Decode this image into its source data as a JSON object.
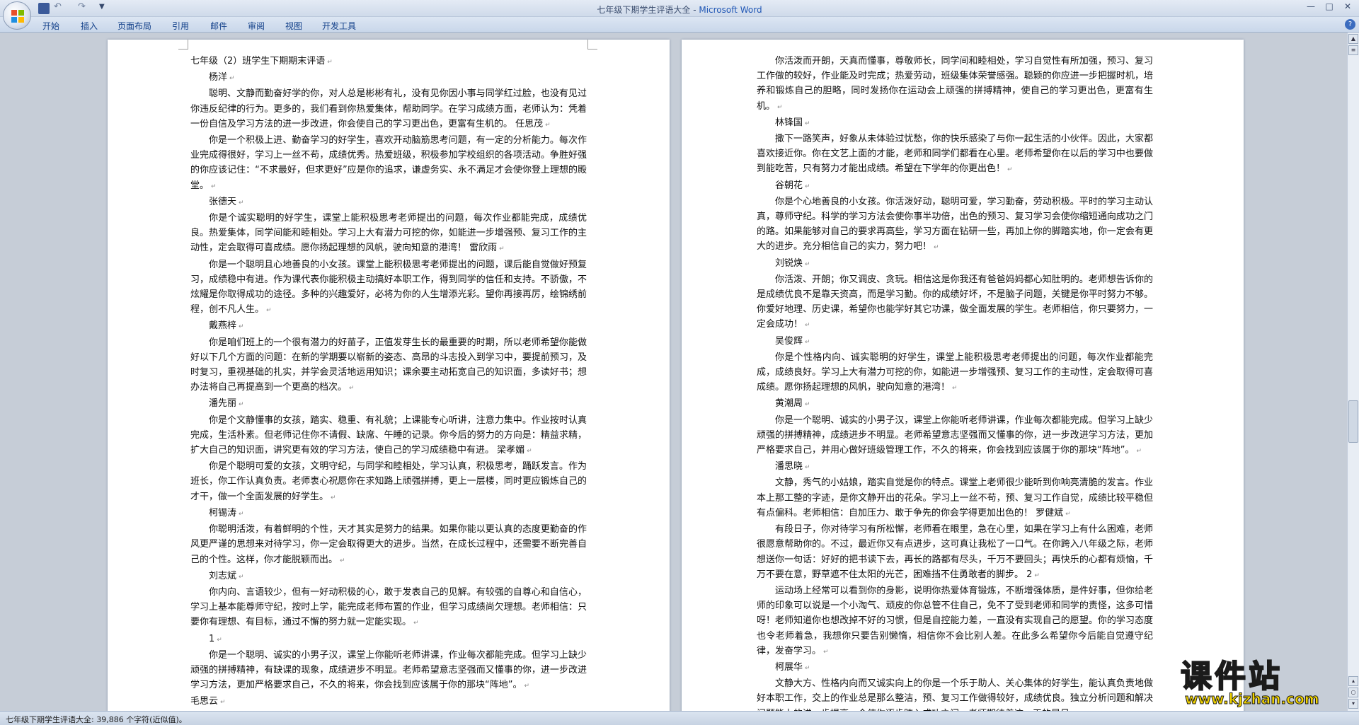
{
  "window": {
    "title_doc": "七年级下期学生评语大全 - ",
    "title_app": "Microsoft Word",
    "minimize": "—",
    "maximize": "□",
    "close": "✕"
  },
  "quick_access": {
    "undo": "↶",
    "redo": "↷",
    "more": "▼"
  },
  "ribbon_tabs": [
    "开始",
    "插入",
    "页面布局",
    "引用",
    "邮件",
    "审阅",
    "视图",
    "开发工具"
  ],
  "help_icon": "?",
  "page1": {
    "paragraphs": [
      {
        "kind": "title",
        "text": "七年级（2）班学生下期期末评语"
      },
      {
        "kind": "name",
        "text": "杨洋"
      },
      {
        "kind": "body",
        "text": "聪明、文静而勤奋好学的你，对人总是彬彬有礼，没有见你因小事与同学红过脸，也没有见过你违反纪律的行为。更多的，我们看到你热爱集体，帮助同学。在学习成绩方面，老师认为：凭着一份自信及学习方法的进一步改进，你会使自己的学习更出色，更富有生机的。 任思茂"
      },
      {
        "kind": "body",
        "text": "你是一个积极上进、勤奋学习的好学生，喜欢开动脑筋思考问题，有一定的分析能力。每次作业完成得很好，学习上一丝不苟，成绩优秀。热爱班级，积极参加学校组织的各项活动。争胜好强的你应该记住：“不求最好，但求更好”应是你的追求，谦虚务实、永不满足才会使你登上理想的殿堂。"
      },
      {
        "kind": "name",
        "text": "张德天"
      },
      {
        "kind": "body",
        "text": "你是个诚实聪明的好学生，课堂上能积极思考老师提出的问题，每次作业都能完成，成绩优良。热爱集体，同学间能和睦相处。学习上大有潜力可挖的你，如能进一步增强预、复习工作的主动性，定会取得可喜成绩。愿你扬起理想的风帆，驶向知意的港湾！ 雷欣雨"
      },
      {
        "kind": "body",
        "text": "你是一个聪明且心地善良的小女孩。课堂上能积极思考老师提出的问题，课后能自觉做好预复习，成绩稳中有进。作为课代表你能积极主动搞好本职工作，得到同学的信任和支持。不骄傲，不炫耀是你取得成功的途径。多种的兴趣爱好，必将为你的人生增添光彩。望你再接再厉，绘锦绣前程，创不凡人生。"
      },
      {
        "kind": "name",
        "text": "戴燕梓"
      },
      {
        "kind": "body",
        "text": "你是咱们班上的一个很有潜力的好苗子，正值发芽生长的最重要的时期，所以老师希望你能做好以下几个方面的问题：在新的学期要以崭新的姿态、高昂的斗志投入到学习中，要提前预习，及时复习，重视基础的扎实，并学会灵活地运用知识；课余要主动拓宽自己的知识面，多读好书；想办法将自己再提高到一个更高的档次。"
      },
      {
        "kind": "name",
        "text": "潘先丽"
      },
      {
        "kind": "body",
        "text": "你是个文静懂事的女孩，踏实、稳重、有礼貌；上课能专心听讲，注意力集中。作业按时认真完成，生活朴素。但老师记住你不请假、缺席、午睡的记录。你今后的努力的方向是：精益求精，扩大自己的知识面，讲究更有效的学习方法，使自己的学习成绩稳中有进。 梁孝媚"
      },
      {
        "kind": "body",
        "text": "你是个聪明可爱的女孩，文明守纪，与同学和睦相处，学习认真，积极思考，踊跃发言。作为班长，你工作认真负责。老师衷心祝愿你在求知路上顽强拼搏，更上一层楼，同时更应锻炼自己的才干，做一个全面发展的好学生。"
      },
      {
        "kind": "name",
        "text": "柯锡涛"
      },
      {
        "kind": "body",
        "text": "你聪明活泼，有着鲜明的个性，天才其实是努力的结果。如果你能以更认真的态度更勤奋的作风更严谨的思想来对待学习，你一定会取得更大的进步。当然，在成长过程中，还需要不断完善自己的个性。这样，你才能脱颖而出。"
      },
      {
        "kind": "name",
        "text": "刘志斌"
      },
      {
        "kind": "body",
        "text": "你内向、言语较少，但有一好动积极的心，敢于发表自己的见解。有较强的自尊心和自信心，学习上基本能尊师守纪，按时上学，能完成老师布置的作业，但学习成绩尚欠理想。老师相信：只要你有理想、有目标，通过不懈的努力就一定能实现。"
      },
      {
        "kind": "name",
        "text": "1"
      },
      {
        "kind": "body",
        "text": "你是一个聪明、诚实的小男子汉，课堂上你能听老师讲课，作业每次都能完成。但学习上缺少顽强的拼搏精神，有缺课的现象，成绩进步不明显。老师希望意志坚强而又懂事的你，进一步改进学习方法，更加严格要求自己，不久的将来，你会找到应该属于你的那块“阵地”。"
      },
      {
        "kind": "title",
        "text": "毛思云"
      }
    ]
  },
  "page2": {
    "paragraphs": [
      {
        "kind": "body",
        "text": "你活泼而开朗，天真而懂事，尊敬师长，同学间和睦相处，学习自觉性有所加强，预习、复习工作做的较好，作业能及时完成；热爱劳动，班级集体荣誉感强。聪颖的你应进一步把握时机，培养和锻炼自己的胆略，同时发扬你在运动会上顽强的拼搏精神，使自己的学习更出色，更富有生机。"
      },
      {
        "kind": "name",
        "text": "林锋国"
      },
      {
        "kind": "body",
        "text": "撒下一路笑声，好象从未体验过忧愁，你的快乐感染了与你一起生活的小伙伴。因此，大家都喜欢接近你。你在文艺上面的才能，老师和同学们都看在心里。老师希望你在以后的学习中也要做到能吃苦，只有努力才能出成绩。希望在下学年的你更出色！"
      },
      {
        "kind": "name",
        "text": "谷朝花"
      },
      {
        "kind": "body",
        "text": "你是个心地善良的小女孩。你活泼好动，聪明可爱，学习勤奋，劳动积极。平时的学习主动认真，尊师守纪。科学的学习方法会使你事半功倍，出色的预习、复习学习会使你缩短通向成功之门的路。如果能够对自己的要求再高些，学习方面在钻研一些，再加上你的脚踏实地，你一定会有更大的进步。充分相信自己的实力，努力吧！"
      },
      {
        "kind": "name",
        "text": "刘锐焕"
      },
      {
        "kind": "body",
        "text": "你活泼、开朗；你又调皮、贪玩。相信这是你我还有爸爸妈妈都心知肚明的。老师想告诉你的是成绩优良不是靠天资高，而是学习勤。你的成绩好坏，不是脑子问题，关键是你平时努力不够。你爱好地理、历史课，希望你也能学好其它功课，做全面发展的学生。老师相信，你只要努力，一定会成功！"
      },
      {
        "kind": "name",
        "text": "吴俊辉"
      },
      {
        "kind": "body",
        "text": "你是个性格内向、诚实聪明的好学生，课堂上能积极思考老师提出的问题，每次作业都能完成，成绩良好。学习上大有潜力可挖的你，如能进一步增强预、复习工作的主动性，定会取得可喜成绩。愿你扬起理想的风帆，驶向知意的港湾！"
      },
      {
        "kind": "name",
        "text": "黄潮周"
      },
      {
        "kind": "body",
        "text": "你是一个聪明、诚实的小男子汉，课堂上你能听老师讲课，作业每次都能完成。但学习上缺少顽强的拼搏精神，成绩进步不明显。老师希望意志坚强而又懂事的你，进一步改进学习方法，更加严格要求自己，并用心做好班级管理工作，不久的将来，你会找到应该属于你的那块“阵地”。"
      },
      {
        "kind": "name",
        "text": "潘思晓"
      },
      {
        "kind": "body",
        "text": "文静，秀气的小姑娘，踏实自觉是你的特点。课堂上老师很少能听到你响亮清脆的发言。作业本上那工整的字迹，是你文静开出的花朵。学习上一丝不苟，预、复习工作自觉，成绩比较平稳但有点偏科。老师相信：自加压力、敢于争先的你会学得更加出色的！ 罗健斌"
      },
      {
        "kind": "body",
        "text": "有段日子，你对待学习有所松懈，老师看在眼里，急在心里，如果在学习上有什么困难，老师很愿意帮助你的。不过，最近你又有点进步，这可真让我松了一口气。在你跨入八年级之际，老师想送你一句话：好好的把书读下去，再长的路都有尽头，千万不要回头；再快乐的心都有烦恼，千万不要在意，野草遮不住太阳的光芒，困难挡不住勇敢者的脚步。 2"
      },
      {
        "kind": "body",
        "text": "运动场上经常可以看到你的身影，说明你热爱体育锻炼，不断增强体质，是件好事，但你给老师的印象可以说是一个小淘气、顽皮的你总管不住自己，免不了受到老师和同学的责怪，这多可惜呀！老师知道你也想改掉不好的习惯，但是自控能力差，一直没有实现自己的愿望。你的学习态度也令老师着急，我想你只要告别懒惰，相信你不会比别人差。在此多么希望你今后能自觉遵守纪律，发奋学习。"
      },
      {
        "kind": "name",
        "text": "柯展华"
      },
      {
        "kind": "body",
        "text": "文静大方、性格内向而又诚实向上的你是一个乐于助人、关心集体的好学生，能认真负责地做好本职工作，交上的作业总是那么整洁，预、复习工作做得较好，成绩优良。独立分析问题和解决问题能力的进一步提高，会使你逐步跨入成功之门。老师期待着这一天的早日"
      }
    ]
  },
  "status_bar": {
    "text": "七年级下期学生评语大全: 39,886 个字符(近似值)。"
  },
  "watermark": {
    "title": "课件站",
    "url": "www.kjzhan.com"
  }
}
